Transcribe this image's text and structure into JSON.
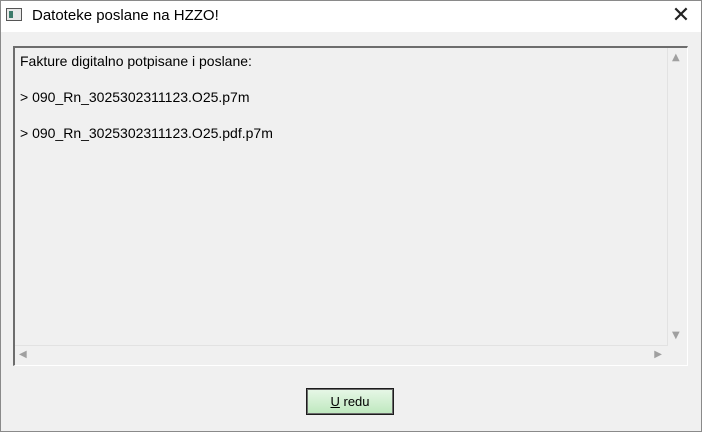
{
  "window": {
    "title": "Datoteke poslane na HZZO!",
    "close_glyph": "✕"
  },
  "message": {
    "heading": "Fakture digitalno potpisane i poslane:",
    "files": [
      "> 090_Rn_3025302311123.O25.p7m",
      "> 090_Rn_3025302311123.O25.pdf.p7m"
    ]
  },
  "scrollbars": {
    "up_glyph": "▲",
    "down_glyph": "▼",
    "left_glyph": "◀",
    "right_glyph": "▶"
  },
  "ok_button": {
    "mnemonic": "U",
    "rest": " redu"
  }
}
